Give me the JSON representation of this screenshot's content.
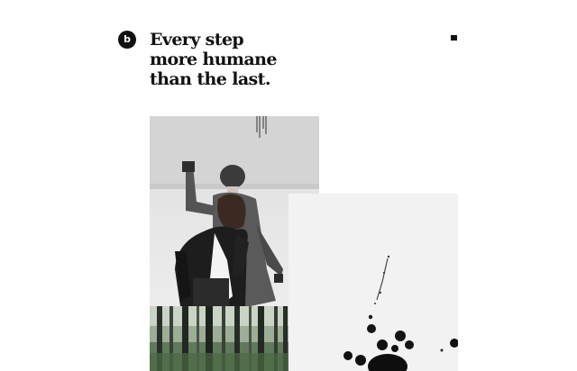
{
  "header": {
    "logo_letter": "b",
    "headline_lines": [
      "Every step",
      "more humane",
      "than the last."
    ],
    "menu_icon": "hamburger-icon"
  },
  "gallery": {
    "photos": [
      {
        "subject": "two people in black jackets"
      },
      {
        "subject": "ink drops on white paper"
      },
      {
        "subject": "forest trees"
      }
    ]
  },
  "colors": {
    "background": "#ffffff",
    "text": "#111111"
  }
}
